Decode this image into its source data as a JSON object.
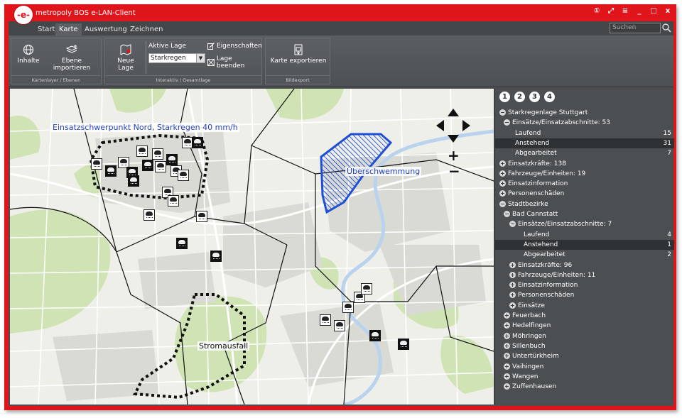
{
  "app": {
    "title": "metropoly BOS e-LAN-Client",
    "logo_text": "-e-"
  },
  "window_controls": [
    "①",
    "⤢",
    "≡",
    "_",
    "□",
    "x"
  ],
  "menu": {
    "tabs": [
      "Start",
      "Karte",
      "Auswertung",
      "Zeichnen"
    ],
    "active": "Karte",
    "search_placeholder": "Suchen"
  },
  "ribbon": {
    "groups": [
      {
        "label": "Kartenlayer / Ebenen",
        "buttons": [
          "Inhalte",
          "Ebene importieren"
        ]
      },
      {
        "label": "Interaktiv / Gesamtlage",
        "new_button": "Neue Lage",
        "active_label": "Aktive Lage",
        "active_value": "Starkregen",
        "props": "Eigenschaften",
        "end": "Lage beenden"
      },
      {
        "label": "Bildexport",
        "buttons": [
          "Karte exportieren"
        ]
      }
    ]
  },
  "map": {
    "labels": {
      "einsatz": "Einsatzschwerpunkt Nord, Starkregen 40 mm/h",
      "flood": "Überschwemmung",
      "outage": "Stromausfall"
    },
    "zoom_in": "+",
    "zoom_out": "−"
  },
  "panel": {
    "steps": [
      "1",
      "2",
      "3",
      "4"
    ],
    "tree": [
      {
        "label": "Starkregenlage Stuttgart",
        "level": 0,
        "toggle": "−"
      },
      {
        "label": "Einsätze/Einsatzabschnitte: 53",
        "level": 1,
        "toggle": "−"
      },
      {
        "label": "Laufend",
        "level": 2,
        "count": "15"
      },
      {
        "label": "Anstehend",
        "level": 2,
        "count": "31",
        "highlight": true
      },
      {
        "label": "Abgearbeitet",
        "level": 2,
        "count": "7"
      },
      {
        "label": "Einsatzkräfte: 138",
        "level": 0,
        "toggle": "+"
      },
      {
        "label": "Fahrzeuge/Einheiten: 19",
        "level": 0,
        "toggle": "+"
      },
      {
        "label": "Einsatzinformation",
        "level": 0,
        "toggle": "+"
      },
      {
        "label": "Personenschäden",
        "level": 0,
        "toggle": "+"
      },
      {
        "label": "Stadtbezirke",
        "level": 0,
        "toggle": "−"
      },
      {
        "label": "Bad Cannstatt",
        "level": 1,
        "toggle": "−"
      },
      {
        "label": "Einsätze/Einsatzabschnitte: 7",
        "level": 2,
        "toggle": "−"
      },
      {
        "label": "Laufend",
        "level": 3,
        "count": "4"
      },
      {
        "label": "Anstehend",
        "level": 3,
        "count": "1",
        "highlight": true
      },
      {
        "label": "Abgearbeitet",
        "level": 3,
        "count": "2"
      },
      {
        "label": "Einsatzkräfte: 96",
        "level": 2,
        "toggle": "+"
      },
      {
        "label": "Fahrzeuge/Einheiten: 11",
        "level": 2,
        "toggle": "+"
      },
      {
        "label": "Einsatzinformation",
        "level": 2,
        "toggle": "+"
      },
      {
        "label": "Personenschäden",
        "level": 2,
        "toggle": "+"
      },
      {
        "label": "Einsätze",
        "level": 2,
        "toggle": "+"
      },
      {
        "label": "Feuerbach",
        "level": 1,
        "toggle": "+"
      },
      {
        "label": "Hedelfingen",
        "level": 1,
        "toggle": "+"
      },
      {
        "label": "Möhringen",
        "level": 1,
        "toggle": "+"
      },
      {
        "label": "Sillenbuch",
        "level": 1,
        "toggle": "+"
      },
      {
        "label": "Untertürkheim",
        "level": 1,
        "toggle": "+"
      },
      {
        "label": "Vaihingen",
        "level": 1,
        "toggle": "+"
      },
      {
        "label": "Wangen",
        "level": 1,
        "toggle": "+"
      },
      {
        "label": "Zuffenhausen",
        "level": 1,
        "toggle": "+"
      }
    ]
  },
  "colors": {
    "frame": "#e0141b",
    "chrome": "#4b4f52",
    "flood": "#1f4fd6",
    "highlight_row": "#2f3234"
  }
}
